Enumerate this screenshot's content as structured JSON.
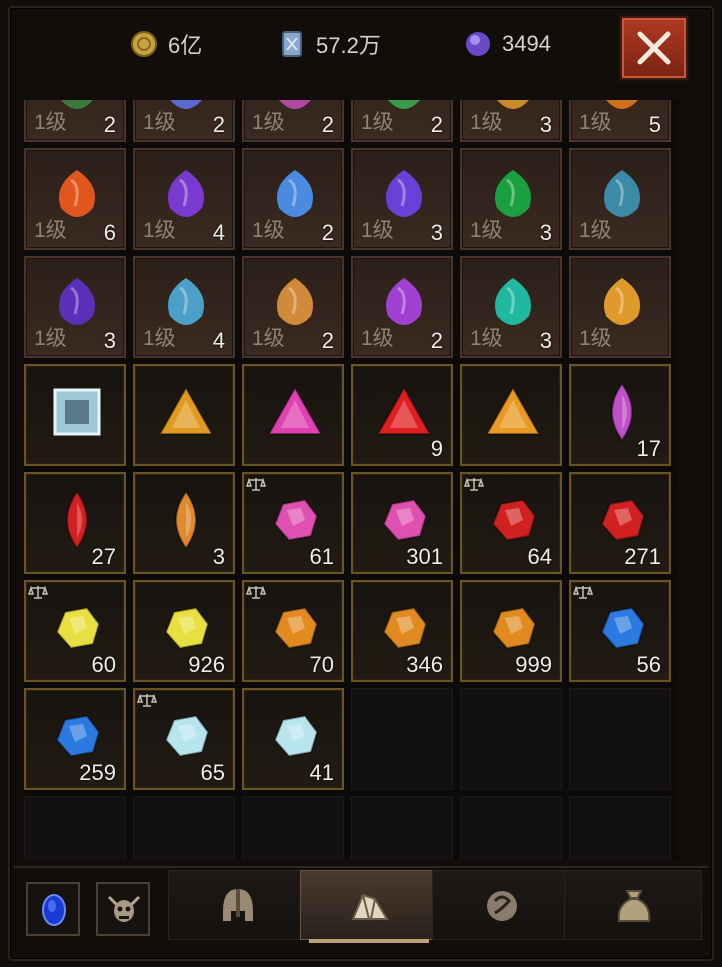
{
  "currencies": [
    {
      "name": "gold",
      "icon": "gold-coin-icon",
      "value": "6亿",
      "color": "#d4b04a"
    },
    {
      "name": "platinum",
      "icon": "platinum-card-icon",
      "value": "57.2万",
      "color": "#9bb7d6"
    },
    {
      "name": "obols",
      "icon": "purple-orb-icon",
      "value": "3494",
      "color": "#8a6ad8"
    }
  ],
  "close_label": "close",
  "grid": {
    "rows": [
      [
        {
          "t": "mat",
          "lvl": "1级",
          "c": "2",
          "col": "#3b7a3a"
        },
        {
          "t": "mat",
          "lvl": "1级",
          "c": "2",
          "col": "#5a6ad0"
        },
        {
          "t": "mat",
          "lvl": "1级",
          "c": "2",
          "col": "#b04aa0"
        },
        {
          "t": "mat",
          "lvl": "1级",
          "c": "2",
          "col": "#3a9a4a"
        },
        {
          "t": "mat",
          "lvl": "1级",
          "c": "3",
          "col": "#c98a2a"
        },
        {
          "t": "mat",
          "lvl": "1级",
          "c": "5",
          "col": "#d0701a"
        }
      ],
      [
        {
          "t": "mat",
          "lvl": "1级",
          "c": "6",
          "col": "#e0561c"
        },
        {
          "t": "mat",
          "lvl": "1级",
          "c": "4",
          "col": "#7a3ad0"
        },
        {
          "t": "mat",
          "lvl": "1级",
          "c": "2",
          "col": "#4a8ae0"
        },
        {
          "t": "mat",
          "lvl": "1级",
          "c": "3",
          "col": "#6a40d8"
        },
        {
          "t": "mat",
          "lvl": "1级",
          "c": "3",
          "col": "#1aa040"
        },
        {
          "t": "mat",
          "lvl": "1级",
          "c": "",
          "col": "#3a8aa8"
        }
      ],
      [
        {
          "t": "mat",
          "lvl": "1级",
          "c": "3",
          "col": "#5a30b8"
        },
        {
          "t": "mat",
          "lvl": "1级",
          "c": "4",
          "col": "#4aa0c8"
        },
        {
          "t": "mat",
          "lvl": "1级",
          "c": "2",
          "col": "#d08a3a"
        },
        {
          "t": "mat",
          "lvl": "1级",
          "c": "2",
          "col": "#a040d0"
        },
        {
          "t": "mat",
          "lvl": "1级",
          "c": "3",
          "col": "#20b8a0"
        },
        {
          "t": "mat",
          "lvl": "1级",
          "c": "",
          "col": "#e09a2a"
        }
      ],
      [
        {
          "t": "gem",
          "shape": "square",
          "c": "",
          "col": "#9ec8d4"
        },
        {
          "t": "gem",
          "shape": "tri",
          "c": "",
          "col": "#e09a20"
        },
        {
          "t": "gem",
          "shape": "tri",
          "c": "",
          "col": "#e040b0"
        },
        {
          "t": "gem",
          "shape": "tri",
          "c": "9",
          "col": "#e02020"
        },
        {
          "t": "gem",
          "shape": "tri",
          "c": "",
          "col": "#e89a22"
        },
        {
          "t": "gem",
          "shape": "marquise",
          "c": "17",
          "col": "#c050c8"
        }
      ],
      [
        {
          "t": "gem",
          "shape": "marquise",
          "c": "27",
          "col": "#d02020",
          "sc": false
        },
        {
          "t": "gem",
          "shape": "marquise",
          "c": "3",
          "col": "#e08a30",
          "sc": false
        },
        {
          "t": "gem",
          "shape": "rough",
          "c": "61",
          "col": "#e050b0",
          "sc": true
        },
        {
          "t": "gem",
          "shape": "rough",
          "c": "301",
          "col": "#e050b0",
          "sc": false
        },
        {
          "t": "gem",
          "shape": "rough",
          "c": "64",
          "col": "#d02020",
          "sc": true
        },
        {
          "t": "gem",
          "shape": "rough",
          "c": "271",
          "col": "#d02020",
          "sc": false
        }
      ],
      [
        {
          "t": "gem",
          "shape": "rough",
          "c": "60",
          "col": "#e8e040",
          "sc": true
        },
        {
          "t": "gem",
          "shape": "rough",
          "c": "926",
          "col": "#e8e040",
          "sc": false
        },
        {
          "t": "gem",
          "shape": "rough",
          "c": "70",
          "col": "#e08a20",
          "sc": true
        },
        {
          "t": "gem",
          "shape": "rough",
          "c": "346",
          "col": "#e08a20",
          "sc": false
        },
        {
          "t": "gem",
          "shape": "rough",
          "c": "999",
          "col": "#e08a20",
          "sc": false
        },
        {
          "t": "gem",
          "shape": "rough",
          "c": "56",
          "col": "#2a7ae0",
          "sc": true
        }
      ],
      [
        {
          "t": "gem",
          "shape": "rough",
          "c": "259",
          "col": "#2a7ae0",
          "sc": false
        },
        {
          "t": "gem",
          "shape": "rough",
          "c": "65",
          "col": "#b8e4ee",
          "sc": true
        },
        {
          "t": "gem",
          "shape": "rough",
          "c": "41",
          "col": "#b8e4ee",
          "sc": false
        },
        {
          "t": "empty"
        },
        {
          "t": "empty"
        },
        {
          "t": "empty"
        }
      ],
      [
        {
          "t": "empty"
        },
        {
          "t": "empty"
        },
        {
          "t": "empty"
        },
        {
          "t": "empty"
        },
        {
          "t": "empty"
        },
        {
          "t": "empty"
        }
      ]
    ]
  },
  "bottom": {
    "buttons": [
      {
        "name": "blue-portal-button",
        "icon": "blue-orb-icon"
      },
      {
        "name": "demon-skull-button",
        "icon": "demon-skull-icon"
      }
    ],
    "tabs": [
      {
        "name": "tab-equipment",
        "icon": "helmet-icon",
        "active": false
      },
      {
        "name": "tab-gems",
        "icon": "gem-pile-icon",
        "active": true
      },
      {
        "name": "tab-consumables",
        "icon": "rune-emblem-icon",
        "active": false
      },
      {
        "name": "tab-materials",
        "icon": "loot-bag-icon",
        "active": false
      }
    ]
  }
}
